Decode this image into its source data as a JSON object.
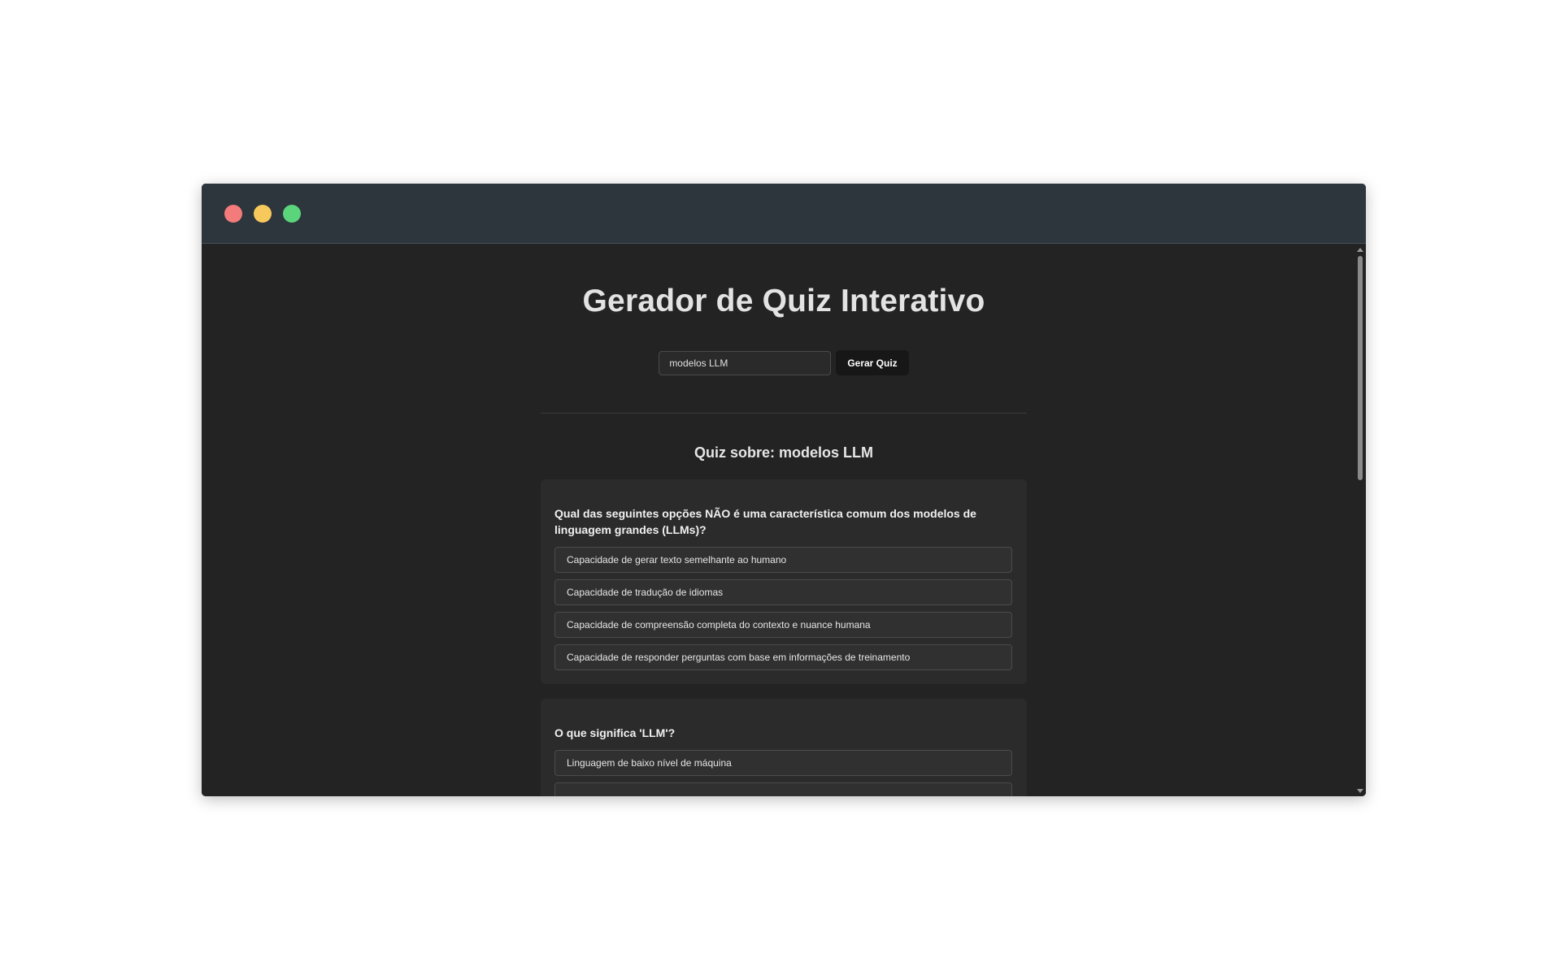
{
  "window": {
    "controls": [
      "close",
      "minimize",
      "maximize"
    ]
  },
  "header": {
    "title": "Gerador de Quiz Interativo"
  },
  "form": {
    "input_value": "modelos LLM",
    "button_label": "Gerar Quiz"
  },
  "quiz": {
    "title": "Quiz sobre: modelos LLM",
    "questions": [
      {
        "text": "Qual das seguintes opções NÃO é uma característica comum dos modelos de linguagem grandes (LLMs)?",
        "options": [
          "Capacidade de gerar texto semelhante ao humano",
          "Capacidade de tradução de idiomas",
          "Capacidade de compreensão completa do contexto e nuance humana",
          "Capacidade de responder perguntas com base em informações de treinamento"
        ]
      },
      {
        "text": "O que significa 'LLM'?",
        "options": [
          "Linguagem de baixo nível de máquina",
          ""
        ]
      }
    ]
  },
  "colors": {
    "titlebar": "#2d353d",
    "page_background": "#232323",
    "card_background": "#2b2b2b",
    "close": "#f37b7b",
    "minimize": "#f7c95c",
    "maximize": "#5ad57c"
  }
}
